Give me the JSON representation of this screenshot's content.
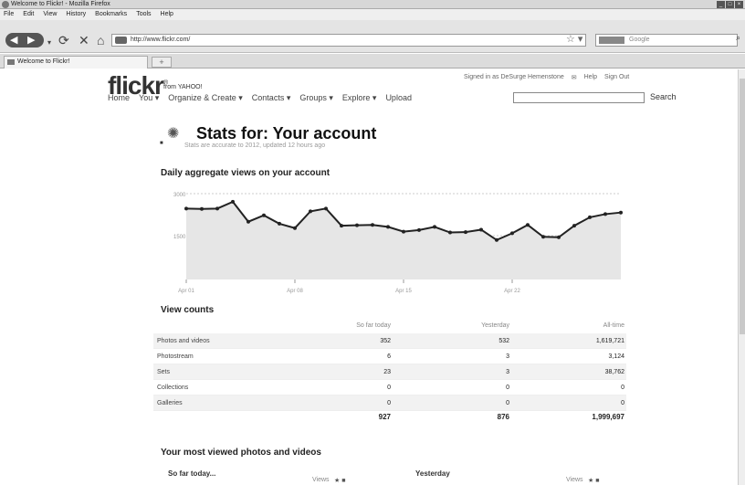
{
  "window": {
    "title": "Welcome to Flickr! - Mozilla Firefox",
    "controls": [
      "_",
      "□",
      "×"
    ]
  },
  "menu": [
    "File",
    "Edit",
    "View",
    "History",
    "Bookmarks",
    "Tools",
    "Help"
  ],
  "toolbar": {
    "url": "http://www.flickr.com/",
    "search_placeholder": "Google"
  },
  "tab": {
    "label": "Welcome to Flickr!",
    "new_tab": "+"
  },
  "flickr": {
    "logo": "flickr",
    "from": "from YAHOO!",
    "signed_in": "Signed in as DeSurge Hemenstone",
    "help": "Help",
    "sign_out": "Sign Out",
    "nav": [
      "Home",
      "You ▾",
      "Organize & Create ▾",
      "Contacts ▾",
      "Groups ▾",
      "Explore ▾",
      "Upload"
    ],
    "search_button": "Search"
  },
  "stats": {
    "title": "Stats for: Your account",
    "subtitle": "Stats are accurate to 2012, updated 12 hours ago",
    "chart_title": "Daily aggregate views on your account",
    "view_counts_title": "View counts",
    "most_viewed_title": "Your most viewed photos and videos",
    "so_far_today": "So far today...",
    "yesterday": "Yesterday",
    "views": "Views"
  },
  "table": {
    "columns": [
      "So far today",
      "Yesterday",
      "All-time"
    ],
    "rows": [
      {
        "label": "Photos and videos",
        "today": "352",
        "yesterday": "532",
        "alltime": "1,619,721"
      },
      {
        "label": "Photostream",
        "today": "6",
        "yesterday": "3",
        "alltime": "3,124"
      },
      {
        "label": "Sets",
        "today": "23",
        "yesterday": "3",
        "alltime": "38,762"
      },
      {
        "label": "Collections",
        "today": "0",
        "yesterday": "0",
        "alltime": "0"
      },
      {
        "label": "Galleries",
        "today": "0",
        "yesterday": "0",
        "alltime": "0"
      }
    ],
    "totals": {
      "today": "927",
      "yesterday": "876",
      "alltime": "1,999,697"
    }
  },
  "chart_data": {
    "type": "area",
    "title": "Daily aggregate views on your account",
    "y_tick_labels": [
      "3000",
      "1500"
    ],
    "x_tick_labels": [
      "Apr 01",
      "Apr 08",
      "Apr 15",
      "Apr 22"
    ],
    "values": [
      1780,
      1770,
      1780,
      1950,
      1450,
      1610,
      1400,
      1290,
      1710,
      1780,
      1350,
      1360,
      1370,
      1320,
      1200,
      1240,
      1320,
      1180,
      1190,
      1250,
      990,
      1160,
      1370,
      1070,
      1060,
      1350,
      1560,
      1640,
      1680
    ],
    "ylim": [
      0,
      2200
    ],
    "grid": true
  },
  "colors": {
    "line": "#222222",
    "area": "#e6e6e6"
  }
}
